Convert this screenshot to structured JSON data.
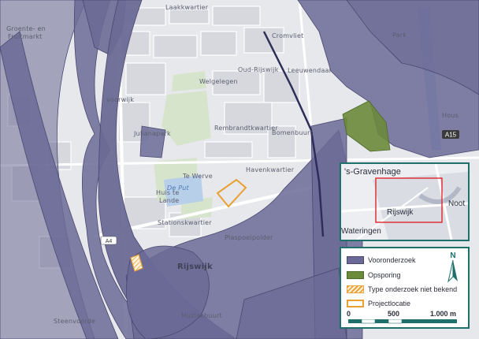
{
  "map": {
    "place_labels": [
      {
        "key": "laakkwartier",
        "text": "Laakkwartier"
      },
      {
        "key": "groente",
        "text": "Groente- en"
      },
      {
        "key": "fruitmarkt",
        "text": "Fruitmarkt"
      },
      {
        "key": "cromvliet",
        "text": "Cromvliet"
      },
      {
        "key": "oud_rijswijk",
        "text": "Oud-Rijswijk"
      },
      {
        "key": "leeuwendaal",
        "text": "Leeuwendaal"
      },
      {
        "key": "welgelegen",
        "text": "Welgelegen"
      },
      {
        "key": "voorwijk",
        "text": "voorwijk"
      },
      {
        "key": "julianapark",
        "text": "Julianapark"
      },
      {
        "key": "rembrandtkwartier",
        "text": "Rembrandtkwartier"
      },
      {
        "key": "bomenbuurt",
        "text": "Bomenbuurt"
      },
      {
        "key": "te_werve",
        "text": "Te Werve"
      },
      {
        "key": "havenkwartier",
        "text": "Havenkwartier"
      },
      {
        "key": "huis_te_lande_1",
        "text": "Huis te"
      },
      {
        "key": "huis_te_lande_2",
        "text": "Lande"
      },
      {
        "key": "stationskwartier",
        "text": "Stationskwartier"
      },
      {
        "key": "plaspoelpolder",
        "text": "Plaspoelpolder"
      },
      {
        "key": "rijswijk",
        "text": "Rijswijk"
      },
      {
        "key": "steenvoorde",
        "text": "Steenvoorde"
      },
      {
        "key": "muziekbuurt",
        "text": "Muziekbuurt"
      },
      {
        "key": "huis_partial",
        "text": "Hous"
      },
      {
        "key": "park_partial",
        "text": "Park"
      }
    ],
    "water_label": "De Put",
    "road_shields": [
      "A15",
      "A4"
    ]
  },
  "inset": {
    "city_label": "'s-Gravenhage",
    "rijswijk_label": "Rijswijk",
    "nootdorp_label": "Noot",
    "wateringen_label": "Wateringen",
    "border_color": "#1f6f6a",
    "extent_color": "#e0242b"
  },
  "legend": {
    "items": [
      {
        "label": "Vooronderzoek",
        "color": "#6b6a96"
      },
      {
        "label": "Opsporing",
        "color": "#6b8a3a"
      },
      {
        "label": "Type onderzoek niet bekend",
        "color": "#e8a33c"
      },
      {
        "label": "Projectlocatie",
        "color": "#e8a033"
      }
    ],
    "north_letter": "N",
    "scale": {
      "labels": [
        "0",
        "500",
        "1.000 m"
      ]
    }
  }
}
